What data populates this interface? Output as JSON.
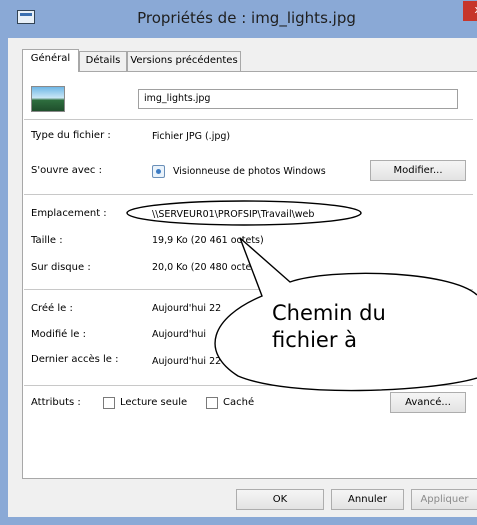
{
  "window": {
    "title": "Propriétés de : img_lights.jpg",
    "close_glyph": "x"
  },
  "tabs": [
    {
      "label": "Général",
      "active": true
    },
    {
      "label": "Détails",
      "active": false
    },
    {
      "label": "Versions précédentes",
      "active": false
    }
  ],
  "general": {
    "file_name": "img_lights.jpg",
    "file_icon": "image-thumbnail-icon",
    "type_label": "Type du fichier :",
    "type_value": "Fichier JPG (.jpg)",
    "opens_label": "S'ouvre avec :",
    "opens_value": "Visionneuse de photos Windows",
    "opens_icon": "photo-viewer-icon",
    "modify_button": "Modifier...",
    "location_label": "Emplacement :",
    "location_value": "\\\\SERVEUR01\\PROFSIP\\Travail\\web",
    "size_label": "Taille :",
    "size_value": "19,9 Ko (20 461 octets)",
    "disk_label": "Sur disque :",
    "disk_value": "20,0 Ko (20 480 octets)",
    "created_label": "Créé le :",
    "created_value": "Aujourd'hui 22",
    "modified_label": "Modifié le :",
    "modified_value": "Aujourd'hui",
    "accessed_label": "Dernier accès le :",
    "accessed_value": "Aujourd'hui 22",
    "attributes_label": "Attributs :",
    "readonly_label": "Lecture seule",
    "readonly_checked": false,
    "hidden_label": "Caché",
    "hidden_checked": false,
    "advanced_button": "Avancé..."
  },
  "footer": {
    "ok": "OK",
    "cancel": "Annuler",
    "apply": "Appliquer"
  },
  "annotation": {
    "line1": "Chemin du",
    "line2": "fichier à"
  },
  "colors": {
    "titlebar": "#8aa9d6",
    "close": "#c7362b"
  }
}
